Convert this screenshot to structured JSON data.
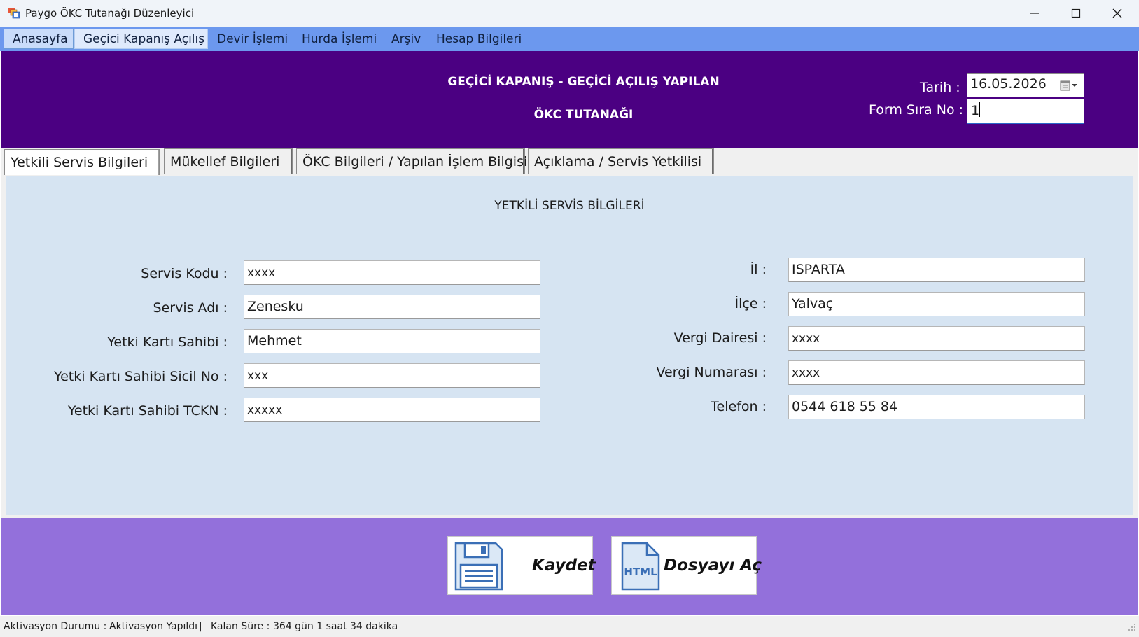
{
  "window": {
    "title": "Paygo ÖKC Tutanağı Düzenleyici"
  },
  "menu": {
    "items": [
      {
        "label": "Anasayfa"
      },
      {
        "label": "Geçici Kapanış Açılış"
      },
      {
        "label": "Devir İşlemi"
      },
      {
        "label": "Hurda İşlemi"
      },
      {
        "label": "Arşiv"
      },
      {
        "label": "Hesap Bilgileri"
      }
    ]
  },
  "header": {
    "title_line1": "GEÇİCİ KAPANIŞ - GEÇİCİ AÇILIŞ YAPILAN",
    "title_line2": "ÖKC TUTANAĞI",
    "date_label": "Tarih :",
    "date_value": "16.05.2026",
    "form_no_label": "Form Sıra No :",
    "form_no_value": "1"
  },
  "tabs": [
    {
      "label": "Yetkili Servis Bilgileri"
    },
    {
      "label": "Mükellef Bilgileri"
    },
    {
      "label": "ÖKC Bilgileri / Yapılan İşlem Bilgisi"
    },
    {
      "label": "Açıklama / Servis Yetkilisi"
    }
  ],
  "section": {
    "title": "YETKİLİ SERVİS BİLGİLERİ"
  },
  "left_fields": [
    {
      "label": "Servis Kodu :",
      "value": "xxxx"
    },
    {
      "label": "Servis Adı :",
      "value": "Zenesku"
    },
    {
      "label": "Yetki Kartı Sahibi :",
      "value": "Mehmet"
    },
    {
      "label": "Yetki Kartı Sahibi Sicil No :",
      "value": "xxx"
    },
    {
      "label": "Yetki Kartı Sahibi TCKN :",
      "value": "xxxxx"
    }
  ],
  "right_fields": [
    {
      "label": "İl :",
      "value": "ISPARTA"
    },
    {
      "label": "İlçe  :",
      "value": "Yalvaç"
    },
    {
      "label": "Vergi Dairesi :",
      "value": "xxxx"
    },
    {
      "label": "Vergi Numarası :",
      "value": "xxxx"
    },
    {
      "label": "Telefon :",
      "value": "0544 618 55 84"
    }
  ],
  "actions": {
    "save_label": "Kaydet",
    "open_label": "Dosyayı Aç",
    "html_icon_text": "HTML"
  },
  "status": {
    "activation_label": "Aktivasyon Durumu :",
    "activation_value": "Aktivasyon Yapıldı",
    "separator": "|",
    "remaining_label": "Kalan Süre :",
    "remaining_value": "364 gün 1 saat 34 dakika"
  },
  "colors": {
    "menu_bar": "#6c98ee",
    "header_bg": "#4b0082",
    "content_bg": "#d6e4f2",
    "footer_bg": "#9370db"
  },
  "icons": [
    "app-icon",
    "minimize-icon",
    "maximize-icon",
    "close-icon",
    "calendar-icon",
    "floppy-disk-icon",
    "html-file-icon",
    "resize-grip-icon"
  ]
}
